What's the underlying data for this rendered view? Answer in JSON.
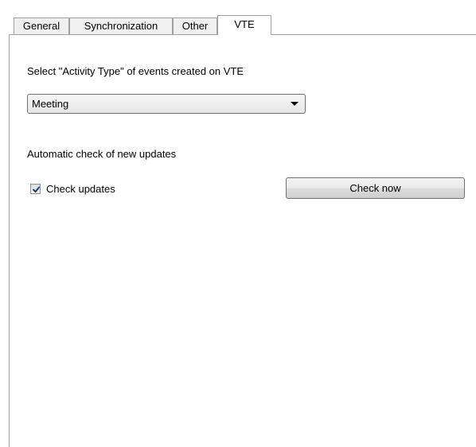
{
  "tabs": [
    {
      "label": "General",
      "active": false
    },
    {
      "label": "Synchronization",
      "active": false
    },
    {
      "label": "Other",
      "active": false
    },
    {
      "label": "VTE",
      "active": true
    }
  ],
  "activity_type": {
    "label": "Select \"Activity Type\" of events created on VTE",
    "selected": "Meeting"
  },
  "updates": {
    "section_label": "Automatic check of new updates",
    "checkbox_label": "Check updates",
    "checked": true,
    "button_label": "Check now"
  }
}
